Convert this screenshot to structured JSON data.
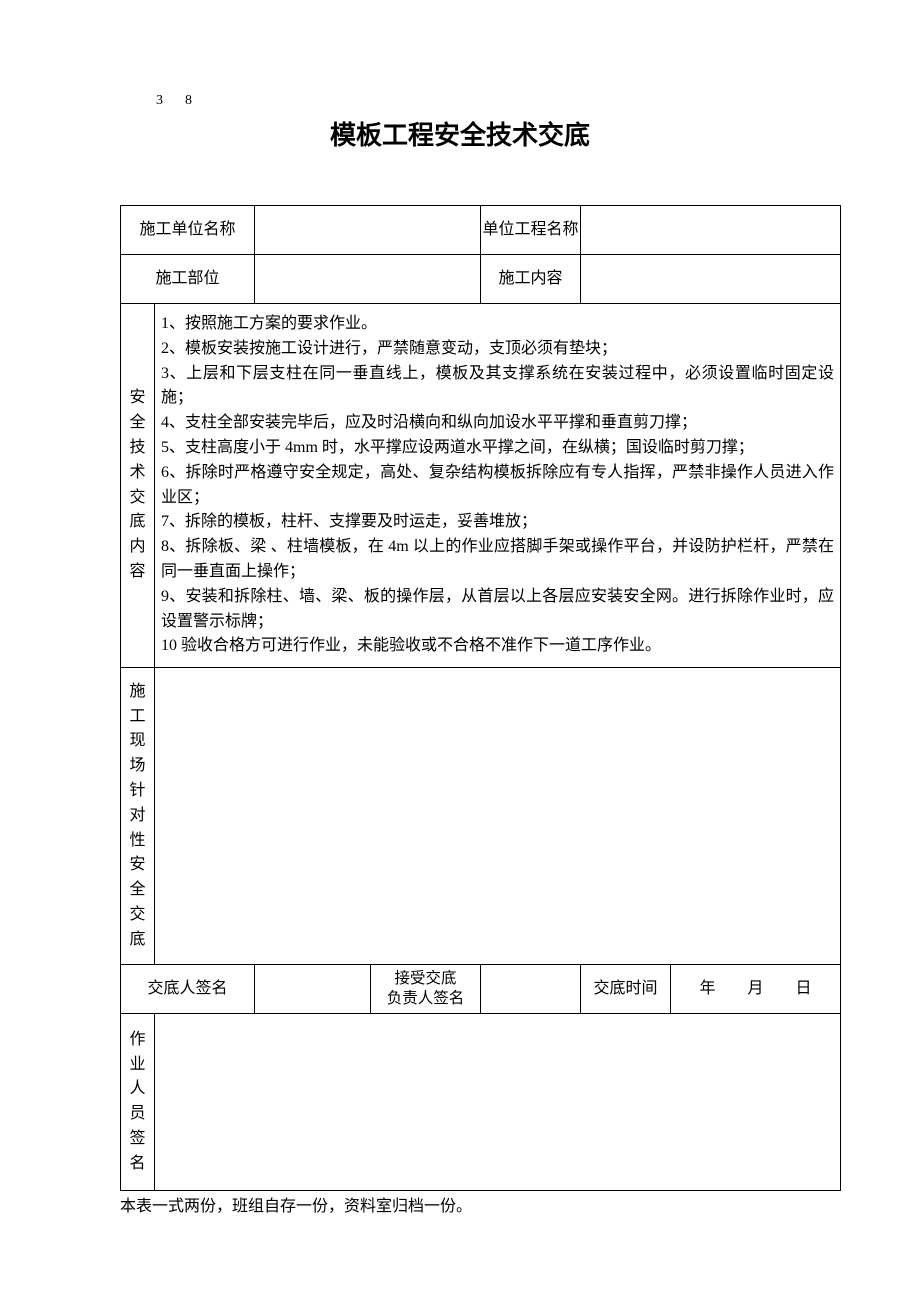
{
  "page_num": "3　8",
  "title": "模板工程安全技术交底",
  "headers": {
    "construction_unit_label": "施工单位名称",
    "project_name_label": "单位工程名称",
    "construction_part_label": "施工部位",
    "construction_content_label": "施工内容",
    "construction_unit_value": "",
    "project_name_value": "",
    "construction_part_value": "",
    "construction_content_value": ""
  },
  "safety_section": {
    "label": "安全技术交底内容",
    "items": [
      "1、按照施工方案的要求作业。",
      "2、模板安装按施工设计进行，严禁随意变动，支顶必须有垫块；",
      "3、上层和下层支柱在同一垂直线上，模板及其支撑系统在安装过程中，必须设置临时固定设施；",
      "4、支柱全部安装完毕后，应及时沿横向和纵向加设水平平撑和垂直剪刀撑；",
      "5、支柱高度小于 4mm 时，水平撑应设两道水平撑之间，在纵横；国设临时剪刀撑；",
      "6、拆除时严格遵守安全规定，高处、复杂结构模板拆除应有专人指挥，严禁非操作人员进入作业区；",
      "7、拆除的模板，柱杆、支撑要及时运走，妥善堆放；",
      "8、拆除板、梁 、柱墙模板，在 4m 以上的作业应搭脚手架或操作平台，并设防护栏杆，严禁在同一垂直面上操作；",
      "9、安装和拆除柱、墙、梁、板的操作层，从首层以上各层应安装安全网。进行拆除作业时，应设置警示标牌；",
      "10 验收合格方可进行作业，未能验收或不合格不准作下一道工序作业。"
    ]
  },
  "site_section": {
    "label": "施工现场针对性安全交底",
    "content": ""
  },
  "sign_row": {
    "disclosure_person_label": "交底人签名",
    "disclosure_person_value": "",
    "accept_person_label_line1": "接受交底",
    "accept_person_label_line2": "负责人签名",
    "accept_person_value": "",
    "time_label": "交底时间",
    "date_year": "年",
    "date_month": "月",
    "date_day": "日"
  },
  "operator_section": {
    "label": "作业人员签名",
    "content": ""
  },
  "footer_note": "本表一式两份，班组自存一份，资料室归档一份。"
}
